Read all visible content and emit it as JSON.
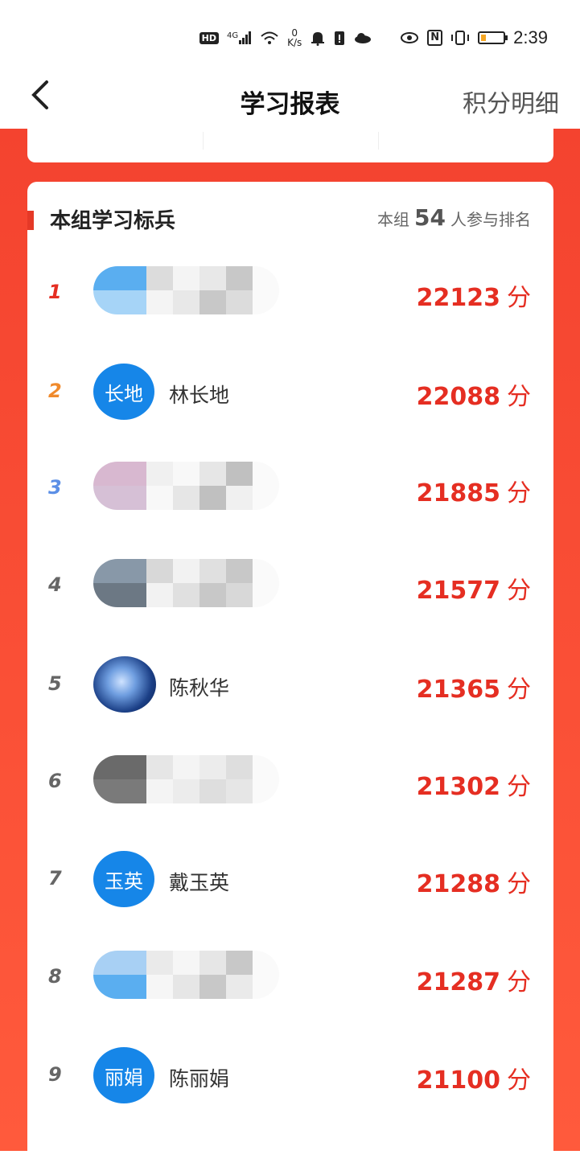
{
  "status_bar": {
    "hd": "HD",
    "signal": "4G",
    "net_speed_value": "0",
    "net_speed_unit": "K/s",
    "nfc": "N",
    "time": "2:39"
  },
  "nav": {
    "back_glyph": "<",
    "title": "学习报表",
    "right_link": "积分明细"
  },
  "card": {
    "title": "本组学习标兵",
    "participants_prefix": "本组",
    "participants_count": "54",
    "participants_suffix": "人参与排名"
  },
  "rankings": [
    {
      "rank": "1",
      "avatar_text": "",
      "name": "",
      "score": "22123",
      "unit": "分",
      "rank_color": "#e52e22"
    },
    {
      "rank": "2",
      "avatar_text": "长地",
      "name": "林长地",
      "score": "22088",
      "unit": "分",
      "rank_color": "#f08a2c"
    },
    {
      "rank": "3",
      "avatar_text": "",
      "name": "",
      "score": "21885",
      "unit": "分",
      "rank_color": "#5b8fe6"
    },
    {
      "rank": "4",
      "avatar_text": "",
      "name": "",
      "score": "21577",
      "unit": "分",
      "rank_color": "#666666"
    },
    {
      "rank": "5",
      "avatar_text": "",
      "name": "陈秋华",
      "score": "21365",
      "unit": "分",
      "rank_color": "#666666"
    },
    {
      "rank": "6",
      "avatar_text": "",
      "name": "",
      "score": "21302",
      "unit": "分",
      "rank_color": "#666666"
    },
    {
      "rank": "7",
      "avatar_text": "玉英",
      "name": "戴玉英",
      "score": "21288",
      "unit": "分",
      "rank_color": "#666666"
    },
    {
      "rank": "8",
      "avatar_text": "",
      "name": "",
      "score": "21287",
      "unit": "分",
      "rank_color": "#666666"
    },
    {
      "rank": "9",
      "avatar_text": "丽娟",
      "name": "陈丽娟",
      "score": "21100",
      "unit": "分",
      "rank_color": "#666666"
    }
  ],
  "colors": {
    "accent_red": "#e52e22",
    "background_red": "#f4432f",
    "avatar_blue": "#1686e8"
  }
}
